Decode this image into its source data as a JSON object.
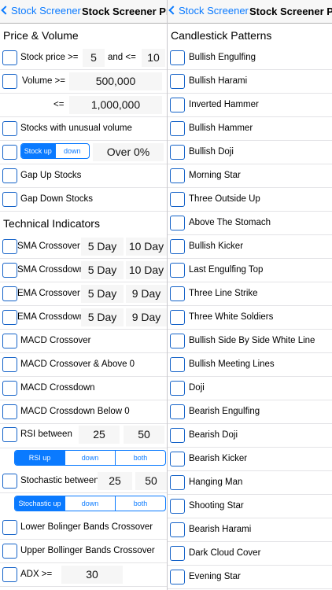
{
  "left": {
    "nav": {
      "back": "Stock Screener",
      "title": "Stock Screener Pro"
    },
    "price_volume": {
      "title": "Price & Volume",
      "stock_price_label": "Stock price >=",
      "price_min": "5",
      "and_label": "and <=",
      "price_max": "10",
      "volume_label": "Volume >=",
      "volume_min": "500,000",
      "volume_le_label": "<=",
      "volume_max": "1,000,000",
      "unusual_volume": "Stocks with unusual volume",
      "direction_up": "Stock up",
      "direction_down": "down",
      "change": "Over 0%",
      "gap_up": "Gap Up Stocks",
      "gap_down": "Gap Down Stocks"
    },
    "technical": {
      "title": "Technical Indicators",
      "sma_crossover": {
        "label": "SMA Crossover",
        "fast": "5 Day",
        "slow": "10 Day"
      },
      "sma_crossdown": {
        "label": "SMA Crossdown",
        "fast": "5 Day",
        "slow": "10 Day"
      },
      "ema_crossover": {
        "label": "EMA Crossover",
        "fast": "5 Day",
        "slow": "9 Day"
      },
      "ema_crossdown": {
        "label": "EMA Crossdown",
        "fast": "5 Day",
        "slow": "9 Day"
      },
      "macd_crossover": "MACD Crossover",
      "macd_crossover_above": "MACD Crossover & Above 0",
      "macd_crossdown": "MACD Crossdown",
      "macd_crossdown_below": "MACD Crossdown Below 0",
      "rsi": {
        "label": "RSI between",
        "low": "25",
        "high": "50",
        "seg": [
          "RSI up",
          "down",
          "both"
        ]
      },
      "stochastic": {
        "label": "Stochastic between",
        "low": "25",
        "high": "50",
        "seg": [
          "Stochastic up",
          "down",
          "both"
        ]
      },
      "lower_bollinger": "Lower Bolinger Bands Crossover",
      "upper_bollinger": "Upper Bollinger Bands Crossover",
      "adx": {
        "label": "ADX >=",
        "value": "30"
      }
    }
  },
  "right": {
    "nav": {
      "back": "Stock Screener",
      "title": "Stock Screener Pro"
    },
    "candlestick": {
      "title": "Candlestick Patterns",
      "patterns": [
        "Bullish Engulfing",
        "Bullish Harami",
        "Inverted Hammer",
        "Bullish Hammer",
        "Bullish Doji",
        "Morning Star",
        "Three Outside Up",
        "Above The Stomach",
        "Bullish Kicker",
        "Last Engulfing Top",
        "Three Line Strike",
        "Three White Soldiers",
        "Bullish Side By Side White Line",
        "Bullish Meeting Lines",
        "Doji",
        "Bearish Engulfing",
        "Bearish Doji",
        "Bearish Kicker",
        "Hanging Man",
        "Shooting Star",
        "Bearish Harami",
        "Dark Cloud Cover",
        "Evening Star"
      ]
    }
  }
}
